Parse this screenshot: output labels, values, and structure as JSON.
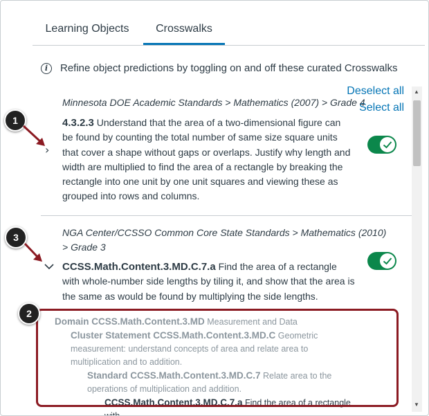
{
  "tabs": {
    "learning_objects": "Learning Objects",
    "crosswalks": "Crosswalks"
  },
  "info_text": "Refine object predictions by toggling on and off these curated Crosswalks",
  "actions": {
    "deselect_all": "Deselect all",
    "select_all": "Select all"
  },
  "crosswalks": [
    {
      "breadcrumb": "Minnesota DOE Academic Standards > Mathematics (2007) > Grade 4",
      "code": "4.3.2.3",
      "description": "Understand that the area of a two-dimensional figure can be found by counting the total number of same size square units that cover a shape without gaps or overlaps. Justify why length and width are multiplied to find the area of a rectangle by breaking the rectangle into one unit by one unit squares and viewing these as grouped into rows and columns.",
      "toggle_on": true,
      "expanded": false
    },
    {
      "breadcrumb_line1": "NGA Center/CCSSO Common Core State Standards > Mathematics (2010)",
      "breadcrumb_line2": "> Grade 3",
      "code": "CCSS.Math.Content.3.MD.C.7.a",
      "description": "Find the area of a rectangle with whole-number side lengths by tiling it, and show that the area is the same as would be found by multiplying the side lengths.",
      "toggle_on": true,
      "expanded": true,
      "hierarchy": {
        "domain_label": "Domain CCSS.Math.Content.3.MD",
        "domain_desc": "Measurement and Data",
        "cluster_label": "Cluster Statement CCSS.Math.Content.3.MD.C",
        "cluster_desc": "Geometric measurement: understand concepts of area and relate area to multiplication and to addition.",
        "standard_label": "Standard CCSS.Math.Content.3.MD.C.7",
        "standard_desc": "Relate area to the operations of multiplication and addition.",
        "item_label": "CCSS.Math.Content.3.MD.C.7.a",
        "item_desc": "Find the area of a rectangle with"
      }
    }
  ],
  "callouts": [
    "1",
    "2",
    "3"
  ],
  "colors": {
    "accent": "#0374b5",
    "toggle": "#0b874b",
    "callout_border": "#8b1a22"
  }
}
